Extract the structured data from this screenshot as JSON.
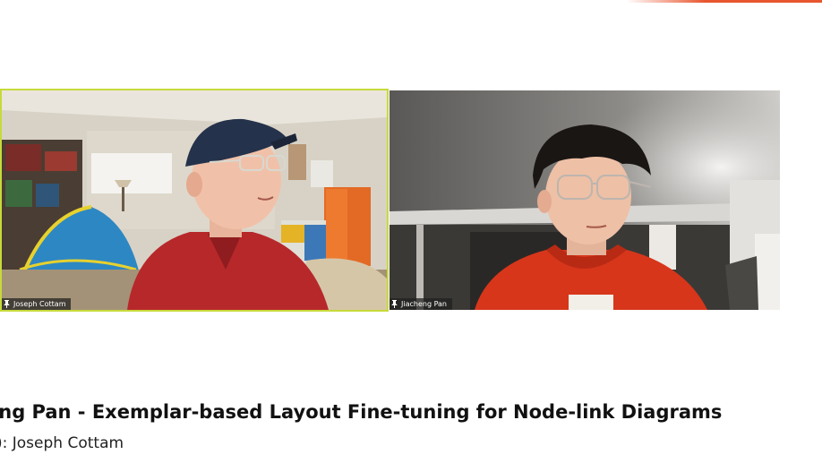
{
  "participants": [
    {
      "name": "Joseph Cottam",
      "pinned": true,
      "active_speaker": true
    },
    {
      "name": "Jiacheng Pan",
      "pinned": true,
      "active_speaker": false
    }
  ],
  "caption": {
    "title": "eng Pan - Exemplar-based Layout Fine-tuning for Node-link Diagrams",
    "subtitle": "): Joseph Cottam"
  },
  "colors": {
    "active_speaker_border": "#c7da3a",
    "top_accent": "#e8562f"
  },
  "icons": {
    "pin": "pin-icon"
  }
}
